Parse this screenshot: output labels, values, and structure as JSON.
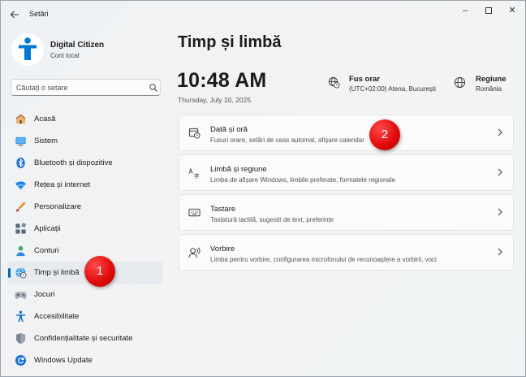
{
  "window": {
    "title": "Setări",
    "back_icon": "arrow-left-icon",
    "controls": {
      "minimize": "–",
      "close": "✕"
    }
  },
  "profile": {
    "name": "Digital Citizen",
    "account_type": "Cont local",
    "avatar_color": "#0078d4"
  },
  "search": {
    "placeholder": "Căutați o setare",
    "value": ""
  },
  "sidebar": {
    "items": [
      {
        "label": "Acasă",
        "icon": "home-icon",
        "active": false
      },
      {
        "label": "Sistem",
        "icon": "system-icon",
        "active": false
      },
      {
        "label": "Bluetooth și dispozitive",
        "icon": "bluetooth-icon",
        "active": false
      },
      {
        "label": "Rețea și internet",
        "icon": "network-icon",
        "active": false
      },
      {
        "label": "Personalizare",
        "icon": "personalization-icon",
        "active": false
      },
      {
        "label": "Aplicații",
        "icon": "apps-icon",
        "active": false
      },
      {
        "label": "Conturi",
        "icon": "accounts-icon",
        "active": false
      },
      {
        "label": "Timp și limbă",
        "icon": "time-language-icon",
        "active": true
      },
      {
        "label": "Jocuri",
        "icon": "gaming-icon",
        "active": false
      },
      {
        "label": "Accesibilitate",
        "icon": "accessibility-icon",
        "active": false
      },
      {
        "label": "Confidențialitate și securitate",
        "icon": "shield-icon",
        "active": false
      },
      {
        "label": "Windows Update",
        "icon": "update-icon",
        "active": false
      }
    ]
  },
  "main": {
    "title": "Timp și limbă",
    "time": "10:48 AM",
    "date": "Thursday, July 10, 2025",
    "timezone": {
      "title": "Fus orar",
      "value": "(UTC+02:00) Atena, București"
    },
    "region": {
      "title": "Regiune",
      "value": "România"
    },
    "cards": [
      {
        "title": "Dată și oră",
        "subtitle": "Fusuri orare, setări de ceas automat, afișare calendar",
        "icon": "calendar-clock-icon"
      },
      {
        "title": "Limbă și regiune",
        "subtitle": "Limba de afișare Windows, limbile preferate, formatele regionale",
        "icon": "language-icon"
      },
      {
        "title": "Tastare",
        "subtitle": "Tastatură tactilă, sugestii de text, preferințe",
        "icon": "keyboard-icon"
      },
      {
        "title": "Vorbire",
        "subtitle": "Limba pentru vorbire, configurarea microfonului de recunoaștere a vorbirii, voci",
        "icon": "speech-icon"
      }
    ]
  },
  "annotations": {
    "badge_1": "1",
    "badge_2": "2",
    "badge_color": "#e20c0c"
  },
  "colors": {
    "accent": "#0067c0"
  }
}
